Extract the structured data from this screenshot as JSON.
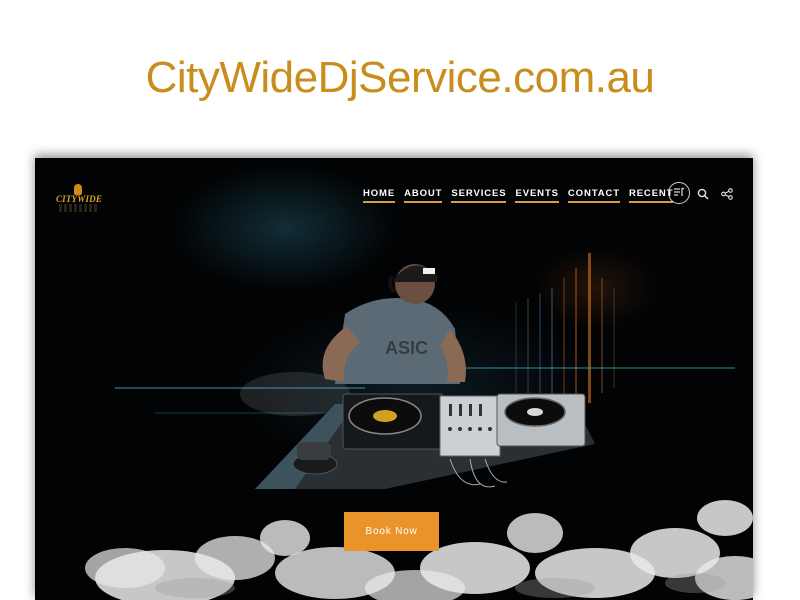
{
  "page": {
    "domain_heading": "CityWideDjService.com.au"
  },
  "header": {
    "logo_text": "CITYWIDE",
    "nav": [
      {
        "label": "HOME"
      },
      {
        "label": "ABOUT"
      },
      {
        "label": "SERVICES"
      },
      {
        "label": "EVENTS"
      },
      {
        "label": "CONTACT"
      },
      {
        "label": "RECENT"
      }
    ],
    "icons": [
      "playlist-icon",
      "search-icon",
      "share-icon"
    ]
  },
  "hero": {
    "image": "dj-at-turntables",
    "cta_label": "Book Now"
  },
  "colors": {
    "brand_orange": "#e8942b",
    "domain_text": "#c98d1e",
    "nav_underline": "#d9a03a",
    "background": "#000000"
  }
}
